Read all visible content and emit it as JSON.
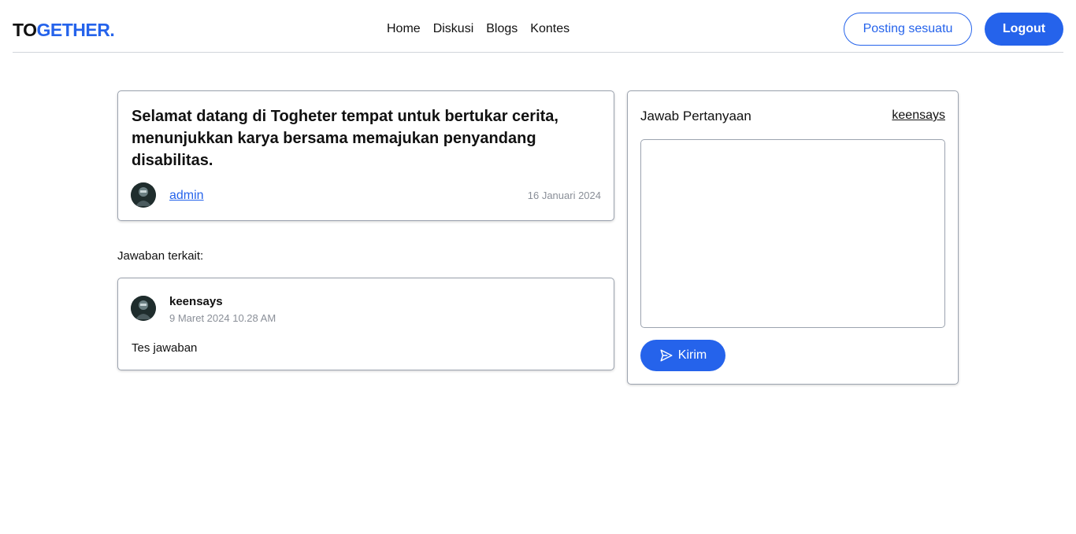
{
  "header": {
    "logo_part1": "TO",
    "logo_part2": "GETHER.",
    "nav": [
      "Home",
      "Diskusi",
      "Blogs",
      "Kontes"
    ],
    "post_button": "Posting sesuatu",
    "logout_button": "Logout"
  },
  "post": {
    "title": "Selamat datang di Togheter tempat untuk bertukar cerita, menunjukkan karya bersama memajukan penyandang disabilitas.",
    "author": "admin",
    "date": "16 Januari 2024"
  },
  "answers": {
    "label": "Jawaban terkait:",
    "items": [
      {
        "user": "keensays",
        "time": "9 Maret 2024 10.28 AM",
        "text": "Tes jawaban"
      }
    ]
  },
  "reply": {
    "title": "Jawab Pertanyaan",
    "user": "keensays",
    "textarea_value": "",
    "send_button": "Kirim"
  },
  "colors": {
    "accent": "#2563eb",
    "muted_text": "#8a8f98",
    "border": "#9ca3af"
  },
  "icons": {
    "avatar": "avatar-icon",
    "send": "send-icon"
  }
}
